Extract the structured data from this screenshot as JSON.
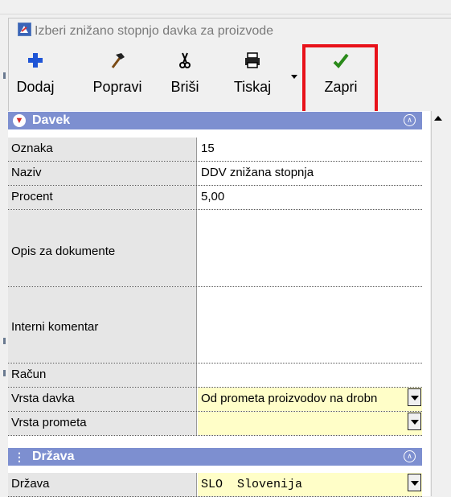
{
  "window": {
    "title": "Izberi znižano stopnjo davka za proizvode"
  },
  "toolbar": {
    "add_label": "Dodaj",
    "edit_label": "Popravi",
    "delete_label": "Briši",
    "print_label": "Tiskaj",
    "close_label": "Zapri",
    "add_icon": "plus-icon",
    "edit_icon": "hammer-icon",
    "delete_icon": "scissors-icon",
    "print_icon": "printer-icon",
    "close_icon": "checkmark-icon",
    "highlight_color": "#e8121a"
  },
  "categories": [
    {
      "label": "Davek",
      "rows": [
        {
          "label": "Oznaka",
          "value": "15"
        },
        {
          "label": "Naziv",
          "value": "DDV znižana stopnja"
        },
        {
          "label": "Procent",
          "value": "5,00"
        },
        {
          "label": "Opis za dokumente",
          "value": ""
        },
        {
          "label": "Interni komentar",
          "value": ""
        },
        {
          "label": "Račun",
          "value": ""
        },
        {
          "label": "Vrsta davka",
          "value": "Od prometa proizvodov na drobn"
        },
        {
          "label": "Vrsta prometa",
          "value": ""
        }
      ]
    },
    {
      "label": "Država",
      "rows": [
        {
          "label": "Država",
          "value": "SLO  Slovenija"
        }
      ]
    }
  ],
  "colors": {
    "category_header": "#7d8fd0",
    "highlighted_value": "#fffec8",
    "label_background": "#e6e6e6"
  }
}
